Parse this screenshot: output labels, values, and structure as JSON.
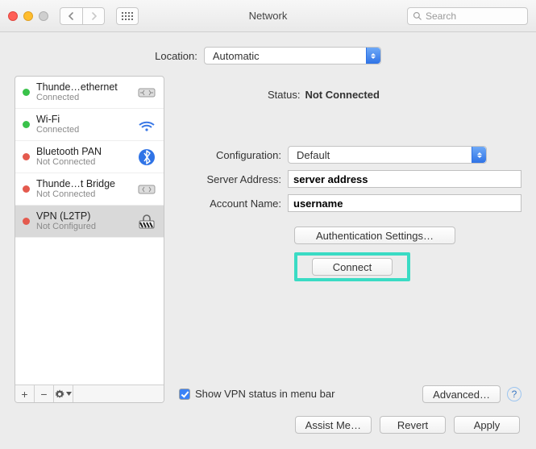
{
  "window": {
    "title": "Network"
  },
  "toolbar": {
    "search_placeholder": "Search"
  },
  "location": {
    "label": "Location:",
    "value": "Automatic"
  },
  "sidebar": {
    "items": [
      {
        "name": "Thunde…ethernet",
        "status": "Connected",
        "dot": "green",
        "icon": "ethernet"
      },
      {
        "name": "Wi-Fi",
        "status": "Connected",
        "dot": "green",
        "icon": "wifi"
      },
      {
        "name": "Bluetooth PAN",
        "status": "Not Connected",
        "dot": "red",
        "icon": "bluetooth"
      },
      {
        "name": "Thunde…t Bridge",
        "status": "Not Connected",
        "dot": "red",
        "icon": "ethernet"
      },
      {
        "name": "VPN (L2TP)",
        "status": "Not Configured",
        "dot": "red",
        "icon": "vpn"
      }
    ],
    "footer": {
      "add": "+",
      "remove": "−"
    }
  },
  "detail": {
    "status_label": "Status:",
    "status_value": "Not Connected",
    "config_label": "Configuration:",
    "config_value": "Default",
    "server_label": "Server Address:",
    "server_value": "server address",
    "account_label": "Account Name:",
    "account_value": "username",
    "auth_button": "Authentication Settings…",
    "connect_button": "Connect",
    "show_status_label": "Show VPN status in menu bar",
    "advanced_button": "Advanced…"
  },
  "footer": {
    "assist": "Assist Me…",
    "revert": "Revert",
    "apply": "Apply"
  }
}
